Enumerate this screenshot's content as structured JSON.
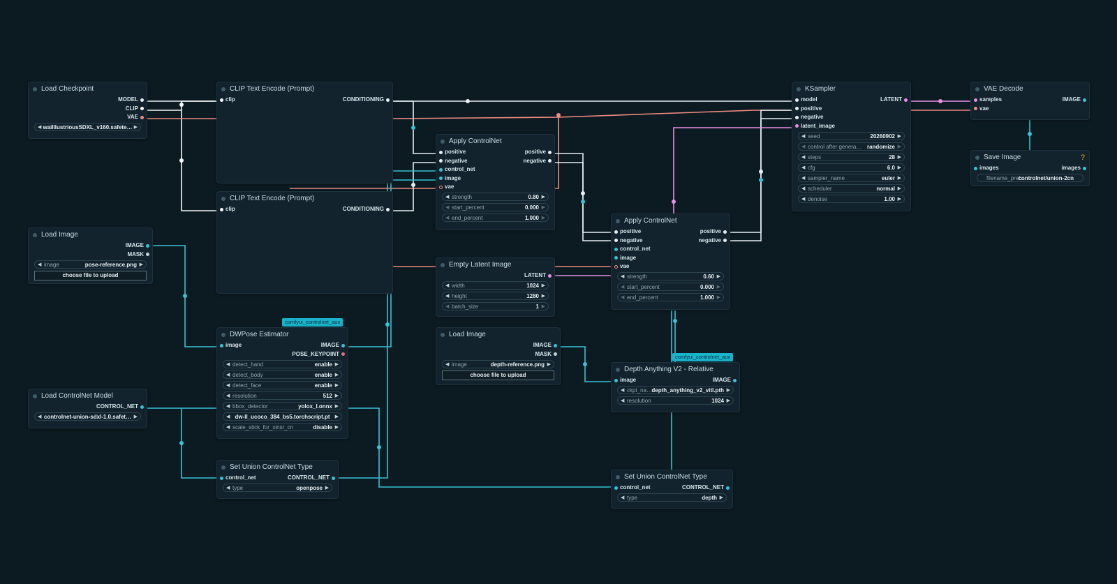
{
  "colors": {
    "background": "#0c1b22",
    "model": "#e6eef2",
    "clip": "#f5f5f5",
    "vae": "#f08a80",
    "conditioning": "#e6eef2",
    "latent": "#e98ee6",
    "image": "#37c2d6",
    "control_net": "#37c2d6",
    "warning": "#e0a428"
  },
  "nodes": {
    "load_checkpoint": {
      "title": "Load Checkpoint",
      "outputs": [
        "MODEL",
        "CLIP",
        "VAE"
      ],
      "ckpt": "waiIllustriousSDXL_v160.safete…"
    },
    "clip_pos": {
      "title": "CLIP Text Encode (Prompt)",
      "input": "clip",
      "output": "CONDITIONING"
    },
    "clip_neg": {
      "title": "CLIP Text Encode (Prompt)",
      "input": "clip",
      "output": "CONDITIONING"
    },
    "load_image_pose": {
      "title": "Load Image",
      "outputs": [
        "IMAGE",
        "MASK"
      ],
      "image_label": "image",
      "image_value": "pose-reference.png",
      "upload": "choose file to upload"
    },
    "dwpose": {
      "badge": "comfyui_controlnet_aux",
      "title": "DWPose Estimator",
      "input": "image",
      "outputs": [
        "IMAGE",
        "POSE_KEYPOINT"
      ],
      "widgets": [
        {
          "label": "detect_hand",
          "value": "enable"
        },
        {
          "label": "detect_body",
          "value": "enable"
        },
        {
          "label": "detect_face",
          "value": "enable"
        },
        {
          "label": "resolution",
          "value": "512"
        },
        {
          "label": "bbox_detector",
          "value": "yolox_l.onnx"
        },
        {
          "label": "",
          "value": "dw-ll_ucoco_384_bs5.torchscript.pt"
        },
        {
          "label": "scale_stick_for_xinsr_cn",
          "value": "disable"
        }
      ]
    },
    "load_controlnet": {
      "title": "Load ControlNet Model",
      "output": "CONTROL_NET",
      "model": "controlnet-union-sdxl-1.0.safet…"
    },
    "set_union_1": {
      "title": "Set Union ControlNet Type",
      "input": "control_net",
      "output": "CONTROL_NET",
      "type_label": "type",
      "type_value": "openpose"
    },
    "apply_cn_1": {
      "title": "Apply ControlNet",
      "inputs": [
        "positive",
        "negative",
        "control_net",
        "image",
        "vae"
      ],
      "outputs": [
        "positive",
        "negative"
      ],
      "widgets": [
        {
          "label": "strength",
          "value": "0.80"
        },
        {
          "label": "start_percent",
          "value": "0.000"
        },
        {
          "label": "end_percent",
          "value": "1.000"
        }
      ]
    },
    "empty_latent": {
      "title": "Empty Latent Image",
      "output": "LATENT",
      "widgets": [
        {
          "label": "width",
          "value": "1024"
        },
        {
          "label": "height",
          "value": "1280"
        },
        {
          "label": "batch_size",
          "value": "1"
        }
      ]
    },
    "load_image_depth": {
      "title": "Load Image",
      "outputs": [
        "IMAGE",
        "MASK"
      ],
      "image_label": "image",
      "image_value": "depth-reference.png",
      "upload": "choose file to upload"
    },
    "apply_cn_2": {
      "title": "Apply ControlNet",
      "inputs": [
        "positive",
        "negative",
        "control_net",
        "image",
        "vae"
      ],
      "outputs": [
        "positive",
        "negative"
      ],
      "widgets": [
        {
          "label": "strength",
          "value": "0.60"
        },
        {
          "label": "start_percent",
          "value": "0.000"
        },
        {
          "label": "end_percent",
          "value": "1.000"
        }
      ]
    },
    "depth_anything": {
      "badge": "comfyui_controlnet_aux",
      "title": "Depth Anything V2 - Relative",
      "input": "image",
      "output": "IMAGE",
      "widgets": [
        {
          "label": "ckpt_na…",
          "value": "depth_anything_v2_vitl.pth"
        },
        {
          "label": "resolution",
          "value": "1024"
        }
      ]
    },
    "set_union_2": {
      "title": "Set Union ControlNet Type",
      "input": "control_net",
      "output": "CONTROL_NET",
      "type_label": "type",
      "type_value": "depth"
    },
    "ksampler": {
      "title": "KSampler",
      "inputs": [
        "model",
        "positive",
        "negative",
        "latent_image"
      ],
      "output": "LATENT",
      "widgets": [
        {
          "label": "seed",
          "value": "20260902"
        },
        {
          "label": "control after genera…",
          "value": "randomize"
        },
        {
          "label": "steps",
          "value": "28"
        },
        {
          "label": "cfg",
          "value": "6.0"
        },
        {
          "label": "sampler_name",
          "value": "euler"
        },
        {
          "label": "scheduler",
          "value": "normal"
        },
        {
          "label": "denoise",
          "value": "1.00"
        }
      ]
    },
    "vae_decode": {
      "title": "VAE Decode",
      "inputs": [
        "samples",
        "vae"
      ],
      "output": "IMAGE"
    },
    "save_image": {
      "title": "Save Image",
      "warning": "?",
      "input": "images",
      "output": "images",
      "prefix_label": "filename_pref…",
      "prefix_value": "controlnet/union-2cn"
    }
  }
}
